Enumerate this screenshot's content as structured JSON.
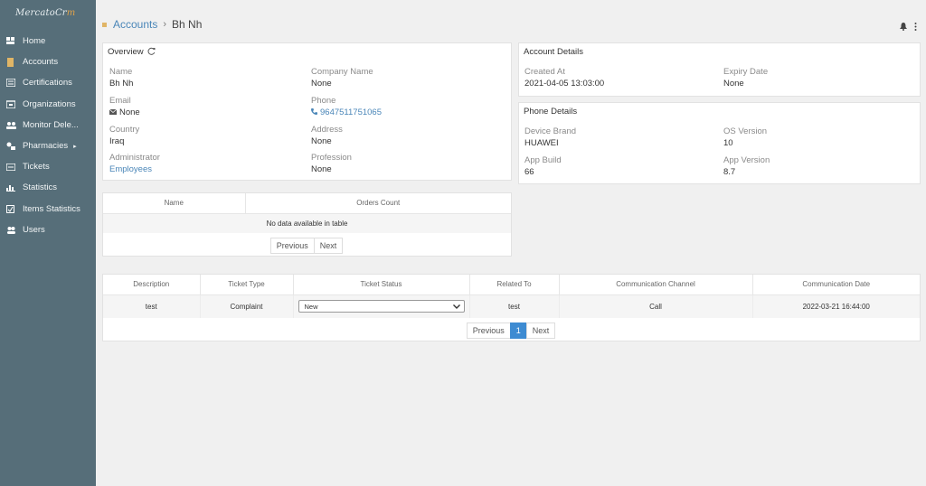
{
  "app": {
    "logo_main": "MercatoCr",
    "logo_accent": "m"
  },
  "sidebar": {
    "items": [
      {
        "label": "Home",
        "icon": "home-icon"
      },
      {
        "label": "Accounts",
        "icon": "accounts-icon"
      },
      {
        "label": "Certifications",
        "icon": "certifications-icon"
      },
      {
        "label": "Organizations",
        "icon": "organizations-icon"
      },
      {
        "label": "Monitor Dele...",
        "icon": "monitor-icon"
      },
      {
        "label": "Pharmacies",
        "icon": "pharmacies-icon"
      },
      {
        "label": "Tickets",
        "icon": "tickets-icon"
      },
      {
        "label": "Statistics",
        "icon": "statistics-icon"
      },
      {
        "label": "Items Statistics",
        "icon": "items-statistics-icon"
      },
      {
        "label": "Users",
        "icon": "users-icon"
      }
    ]
  },
  "breadcrumb": {
    "parent": "Accounts",
    "current": "Bh Nh"
  },
  "overview": {
    "title": "Overview",
    "name_label": "Name",
    "name_value": "Bh Nh",
    "company_label": "Company Name",
    "company_value": "None",
    "email_label": "Email",
    "email_value": "None",
    "phone_label": "Phone",
    "phone_value": "9647511751065",
    "country_label": "Country",
    "country_value": "Iraq",
    "address_label": "Address",
    "address_value": "None",
    "admin_label": "Administrator",
    "admin_value": "Employees",
    "profession_label": "Profession",
    "profession_value": "None"
  },
  "account_details": {
    "title": "Account Details",
    "created_label": "Created At",
    "created_value": "2021-04-05 13:03:00",
    "expiry_label": "Expiry Date",
    "expiry_value": "None"
  },
  "phone_details": {
    "title": "Phone Details",
    "brand_label": "Device Brand",
    "brand_value": "HUAWEI",
    "os_label": "OS Version",
    "os_value": "10",
    "build_label": "App Build",
    "build_value": "66",
    "version_label": "App Version",
    "version_value": "8.7"
  },
  "orders_table": {
    "headers": [
      "Name",
      "Orders Count"
    ],
    "empty_text": "No data available in table",
    "prev": "Previous",
    "next": "Next"
  },
  "tickets_table": {
    "headers": [
      "Description",
      "Ticket Type",
      "Ticket Status",
      "Related To",
      "Communication Channel",
      "Communication Date"
    ],
    "row": {
      "description": "test",
      "type": "Complaint",
      "status": "New",
      "related": "test",
      "channel": "Call",
      "date": "2022-03-21 16:44:00"
    },
    "prev": "Previous",
    "page": "1",
    "next": "Next"
  },
  "colors": {
    "sidebar": "#566e79",
    "accent": "#e0b566",
    "link": "#4a86b8",
    "active_page": "#3d8bd2"
  }
}
